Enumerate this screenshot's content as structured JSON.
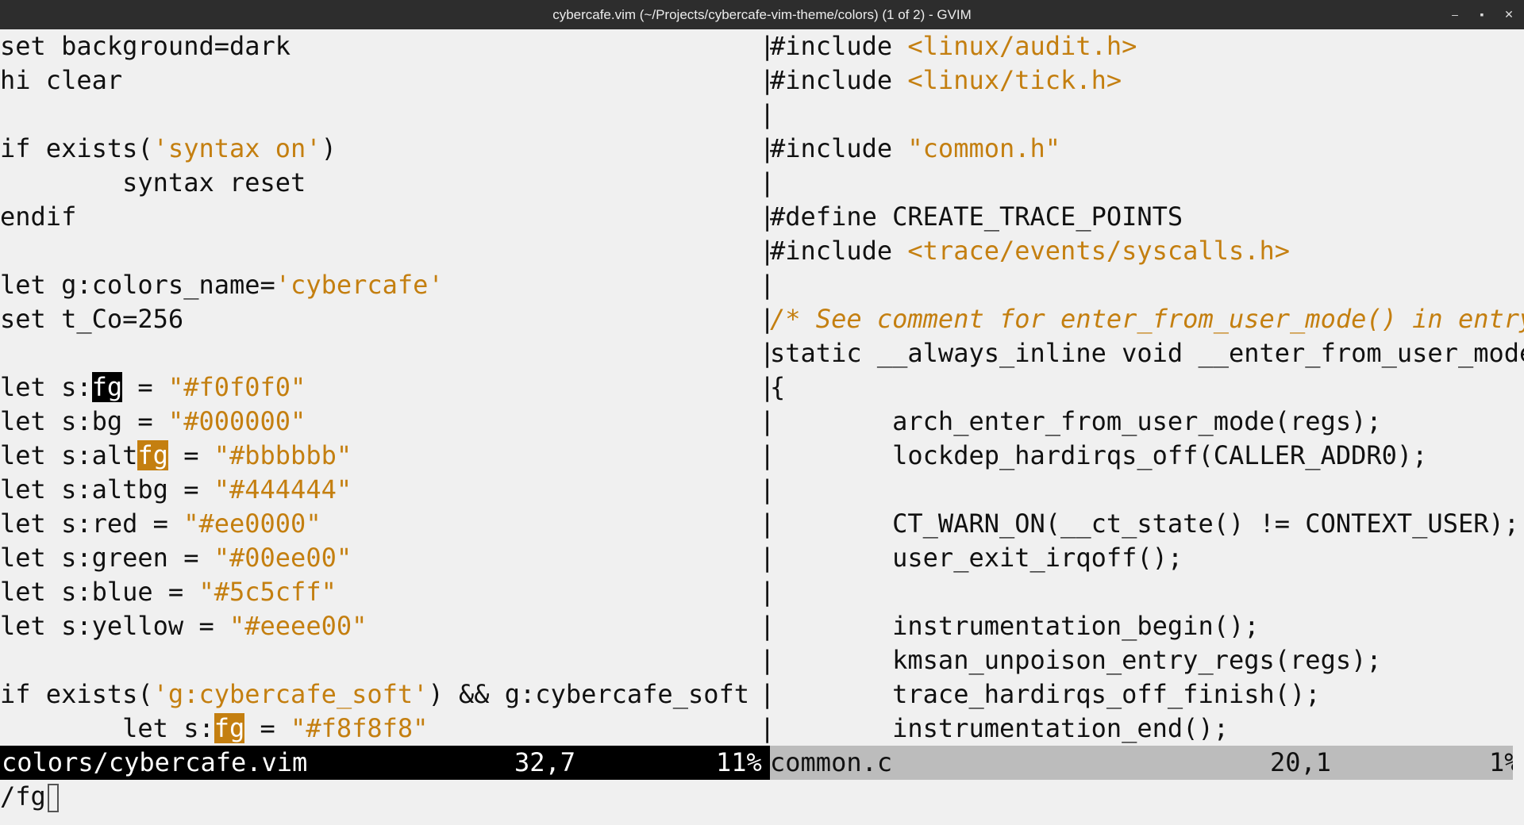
{
  "window": {
    "title": "cybercafe.vim (~/Projects/cybercafe-vim-theme/colors) (1 of 2) - GVIM",
    "controls": {
      "minimize": "‒",
      "maximize": "▪",
      "close": "✕"
    }
  },
  "colors": {
    "background": "#f0f0f0",
    "foreground": "#111111",
    "string": "#c47f10",
    "search_match": "#c47f10",
    "status_active_bg": "#000000",
    "status_inactive_bg": "#bcbcbc",
    "titlebar": "#2d2d2d"
  },
  "left_pane": {
    "lines": [
      [
        {
          "t": "set background=dark"
        }
      ],
      [
        {
          "t": "hi clear"
        }
      ],
      [],
      [
        {
          "t": "if exists("
        },
        {
          "t": "'syntax on'",
          "c": "str"
        },
        {
          "t": ")"
        }
      ],
      [
        {
          "t": "        syntax reset"
        }
      ],
      [
        {
          "t": "endif"
        }
      ],
      [],
      [
        {
          "t": "let g:colors_name="
        },
        {
          "t": "'cybercafe'",
          "c": "str"
        }
      ],
      [
        {
          "t": "set t_Co=256"
        }
      ],
      [],
      [
        {
          "t": "let s:"
        },
        {
          "t": "fg",
          "c": "hl-cur"
        },
        {
          "t": " = "
        },
        {
          "t": "\"#f0f0f0\"",
          "c": "str"
        }
      ],
      [
        {
          "t": "let s:bg = "
        },
        {
          "t": "\"#000000\"",
          "c": "str"
        }
      ],
      [
        {
          "t": "let s:alt"
        },
        {
          "t": "fg",
          "c": "hl-match"
        },
        {
          "t": " = "
        },
        {
          "t": "\"#bbbbbb\"",
          "c": "str"
        }
      ],
      [
        {
          "t": "let s:altbg = "
        },
        {
          "t": "\"#444444\"",
          "c": "str"
        }
      ],
      [
        {
          "t": "let s:red = "
        },
        {
          "t": "\"#ee0000\"",
          "c": "str"
        }
      ],
      [
        {
          "t": "let s:green = "
        },
        {
          "t": "\"#00ee00\"",
          "c": "str"
        }
      ],
      [
        {
          "t": "let s:blue = "
        },
        {
          "t": "\"#5c5cff\"",
          "c": "str"
        }
      ],
      [
        {
          "t": "let s:yellow = "
        },
        {
          "t": "\"#eeee00\"",
          "c": "str"
        }
      ],
      [],
      [
        {
          "t": "if exists("
        },
        {
          "t": "'g:cybercafe_soft'",
          "c": "str"
        },
        {
          "t": ") && g:cybercafe_soft"
        }
      ],
      [
        {
          "t": "        let s:"
        },
        {
          "t": "fg",
          "c": "hl-match"
        },
        {
          "t": " = "
        },
        {
          "t": "\"#f8f8f8\"",
          "c": "str"
        }
      ]
    ]
  },
  "right_pane": {
    "lines": [
      [
        {
          "t": "#include "
        },
        {
          "t": "<linux/audit.h>",
          "c": "str"
        }
      ],
      [
        {
          "t": "#include "
        },
        {
          "t": "<linux/tick.h>",
          "c": "str"
        }
      ],
      [],
      [
        {
          "t": "#include "
        },
        {
          "t": "\"common.h\"",
          "c": "str"
        }
      ],
      [],
      [
        {
          "t": "#define CREATE_TRACE_POINTS"
        }
      ],
      [
        {
          "t": "#include "
        },
        {
          "t": "<trace/events/syscalls.h>",
          "c": "str"
        }
      ],
      [],
      [
        {
          "t": "/* See comment for enter_from_user_mode() in entry-comm",
          "c": "cmt"
        }
      ],
      [
        {
          "t": "static __always_inline void __enter_from_user_mode(stru"
        }
      ],
      [
        {
          "t": "{"
        }
      ],
      [
        {
          "t": "        arch_enter_from_user_mode(regs);"
        }
      ],
      [
        {
          "t": "        lockdep_hardirqs_off(CALLER_ADDR0);"
        }
      ],
      [],
      [
        {
          "t": "        CT_WARN_ON(__ct_state() != CONTEXT_USER);"
        }
      ],
      [
        {
          "t": "        user_exit_irqoff();"
        }
      ],
      [],
      [
        {
          "t": "        instrumentation_begin();"
        }
      ],
      [
        {
          "t": "        kmsan_unpoison_entry_regs(regs);"
        }
      ],
      [
        {
          "t": "        trace_hardirqs_off_finish();"
        }
      ],
      [
        {
          "t": "        instrumentation_end();"
        }
      ]
    ]
  },
  "separator": {
    "char": "|",
    "rows": [
      "|",
      "|",
      "|",
      "|",
      "|",
      "|",
      "|",
      "|",
      "|",
      "|",
      "|",
      "|",
      "|",
      "|",
      "|",
      "|",
      "|",
      "|",
      "|",
      "|",
      "|"
    ]
  },
  "status_left": {
    "file": "colors/cybercafe.vim",
    "position": "32,7",
    "percent": "11%"
  },
  "status_right": {
    "file": "common.c",
    "position": "20,1",
    "percent": "1%"
  },
  "command_line": {
    "text": "/fg"
  }
}
